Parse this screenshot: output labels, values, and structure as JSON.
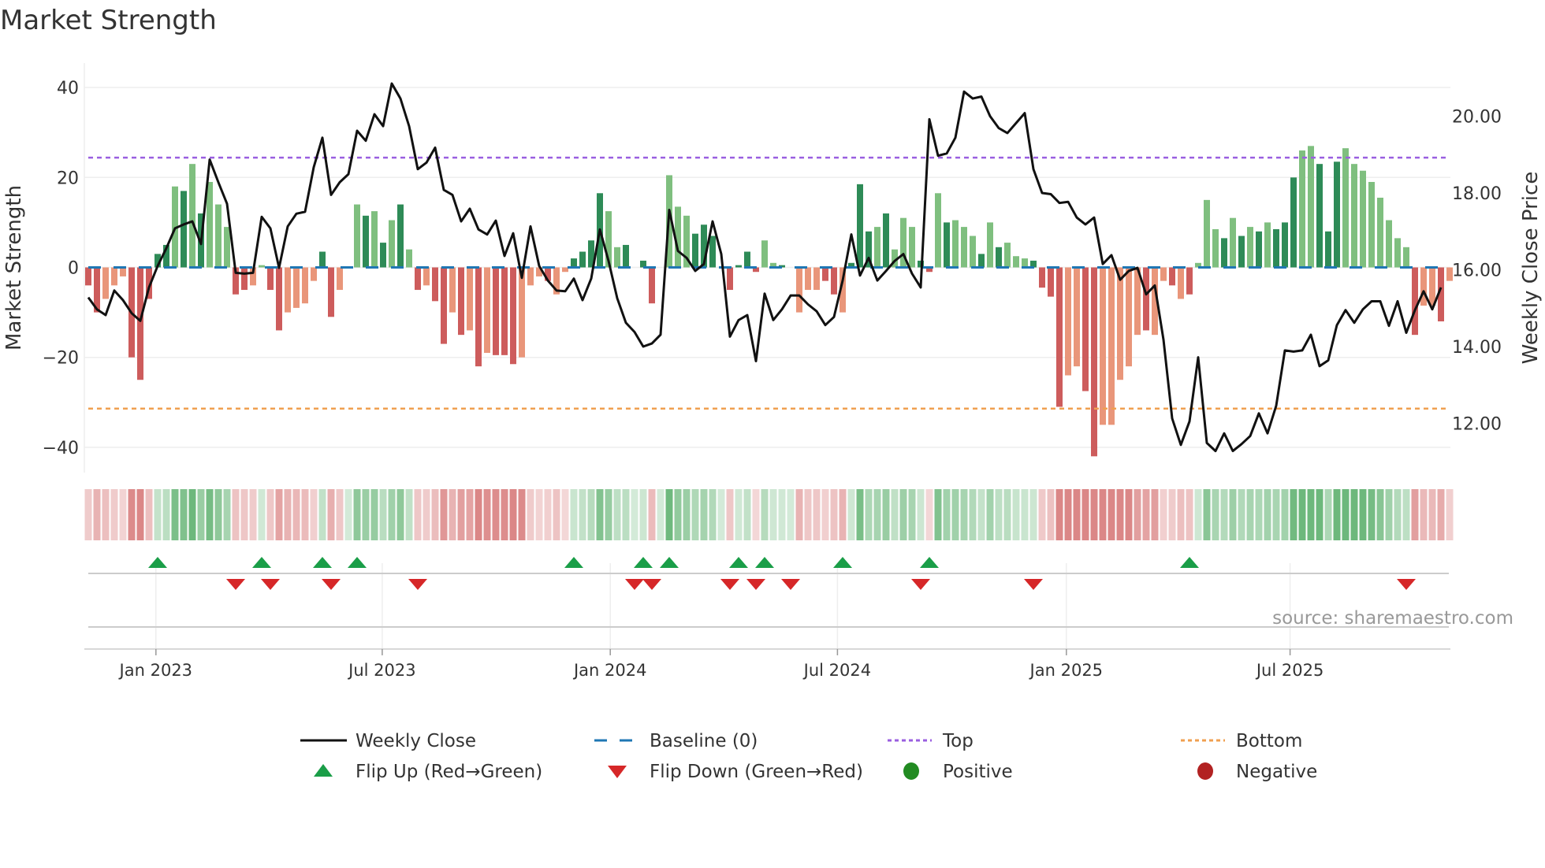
{
  "chart_data": {
    "type": "bar",
    "title": "Market Strength",
    "ylabel": "Market Strength",
    "y2label": "Weekly Close Price",
    "ylim": [
      -45,
      45
    ],
    "y2lim": [
      11.1,
      21.3
    ],
    "yticks": [
      "40",
      "20",
      "0",
      "−20",
      "−40"
    ],
    "ytick_values": [
      40,
      20,
      0,
      -20,
      -40
    ],
    "y2ticks": [
      "20.00",
      "18.00",
      "16.00",
      "14.00",
      "12.00"
    ],
    "y2tick_values": [
      20,
      18,
      16,
      14,
      12
    ],
    "xticks": [
      {
        "label": "Jan 2023",
        "week": 7.8
      },
      {
        "label": "Jul 2023",
        "week": 33.9
      },
      {
        "label": "Jan 2024",
        "week": 60.2
      },
      {
        "label": "Jul 2024",
        "week": 86.4
      },
      {
        "label": "Jan 2025",
        "week": 112.8
      },
      {
        "label": "Jul 2025",
        "week": 138.6
      }
    ],
    "top_threshold": 24.4,
    "bottom_threshold": -31.4,
    "strength": [
      -4,
      -10,
      -7,
      -4,
      -2,
      -20,
      -25,
      -7,
      3,
      5,
      18,
      17,
      23,
      12,
      19,
      14,
      9,
      -6,
      -5,
      -4,
      0.5,
      -5,
      -14,
      -10,
      -9,
      -8,
      -3,
      3.5,
      -11,
      -5,
      0,
      14,
      11.5,
      12.5,
      5.5,
      10.5,
      14,
      4,
      -5,
      -4,
      -7.5,
      -17,
      -10,
      -15,
      -14,
      -22,
      -19,
      -19.5,
      -19.5,
      -21.5,
      -20,
      -4,
      -2,
      -3,
      -6,
      -1,
      2,
      3.5,
      6,
      16.5,
      12.5,
      4.5,
      5,
      0,
      1.5,
      -8,
      0,
      20.5,
      13.5,
      11.5,
      7.5,
      9.5,
      7,
      0,
      -5,
      0.5,
      3.5,
      -1,
      6,
      1,
      0.5,
      0,
      -10,
      -5,
      -5,
      -3,
      -6,
      -10,
      1,
      18.5,
      8,
      9,
      12,
      4,
      11,
      9,
      1.5,
      -1,
      16.5,
      10,
      10.5,
      9,
      7,
      3,
      10,
      4.5,
      5.5,
      2.5,
      2,
      1.5,
      -4.5,
      -6.5,
      -31,
      -24,
      -22,
      -27.5,
      -42,
      -35,
      -35,
      -25,
      -22,
      -15,
      -14,
      -15,
      -3,
      -4,
      -7,
      -6,
      1,
      15,
      8.5,
      6.5,
      11,
      7,
      9,
      8,
      10,
      8.5,
      10,
      20,
      26,
      27,
      23,
      8,
      23.5,
      26.5,
      23,
      21.5,
      19,
      15.5,
      10.5,
      6.5,
      4.5,
      -15,
      -8.5,
      -8.5,
      -12,
      -3
    ],
    "shade": "ddllldddddldldlllddllddllllddldldldldldlddldldldddllldllddddlldddddlllddddddddllddlllddldddldlllddldllldldlllddddllddllllldlldldllldldldldddlldddlllllllldlldl",
    "close": [
      15.28,
      14.97,
      14.82,
      15.46,
      15.21,
      14.87,
      14.67,
      15.54,
      16.1,
      16.56,
      17.08,
      17.18,
      17.26,
      16.67,
      18.87,
      18.28,
      17.72,
      15.92,
      15.9,
      15.92,
      17.38,
      17.08,
      16.05,
      17.13,
      17.46,
      17.51,
      18.67,
      19.44,
      17.95,
      18.28,
      18.49,
      19.62,
      19.36,
      20.05,
      19.74,
      20.85,
      20.46,
      19.74,
      18.62,
      18.79,
      19.18,
      18.08,
      17.95,
      17.26,
      17.59,
      17.05,
      16.92,
      17.28,
      16.36,
      16.95,
      15.79,
      17.13,
      16.1,
      15.72,
      15.46,
      15.44,
      15.77,
      15.21,
      15.77,
      17.05,
      16.23,
      15.26,
      14.62,
      14.38,
      14.0,
      14.08,
      14.31,
      17.56,
      16.49,
      16.31,
      15.97,
      16.15,
      17.26,
      16.41,
      14.26,
      14.69,
      14.82,
      13.62,
      15.38,
      14.69,
      14.97,
      15.33,
      15.33,
      15.1,
      14.92,
      14.56,
      14.77,
      15.72,
      16.92,
      15.85,
      16.31,
      15.72,
      15.97,
      16.23,
      16.41,
      15.9,
      15.54,
      19.92,
      18.97,
      19.03,
      19.44,
      20.64,
      20.46,
      20.51,
      20.0,
      19.69,
      19.56,
      19.82,
      20.08,
      18.62,
      18.0,
      17.97,
      17.74,
      17.77,
      17.36,
      17.18,
      17.36,
      16.15,
      16.38,
      15.74,
      15.97,
      16.05,
      15.36,
      15.59,
      14.18,
      12.13,
      11.44,
      12.05,
      13.72,
      11.49,
      11.28,
      11.74,
      11.28,
      11.46,
      11.67,
      12.26,
      11.74,
      12.46,
      13.9,
      13.87,
      13.9,
      14.31,
      13.49,
      13.64,
      14.56,
      14.95,
      14.62,
      14.97,
      15.18,
      15.18,
      14.54,
      15.18,
      14.36,
      14.95,
      15.44,
      14.97,
      15.54
    ],
    "flip_up_weeks": [
      8,
      20,
      27,
      31,
      56,
      64,
      67,
      75,
      78,
      87,
      97,
      127
    ],
    "flip_down_weeks": [
      17,
      21,
      28,
      38,
      63,
      65,
      74,
      77,
      81,
      96,
      109,
      152
    ],
    "legend": [
      {
        "label": "Weekly Close",
        "kind": "line"
      },
      {
        "label": "Baseline (0)",
        "kind": "dash"
      },
      {
        "label": "Top",
        "kind": "dot-purple"
      },
      {
        "label": "Bottom",
        "kind": "dot-orange"
      },
      {
        "label": "Flip Up (Red→Green)",
        "kind": "tri-up"
      },
      {
        "label": "Flip Down (Green→Red)",
        "kind": "tri-down"
      },
      {
        "label": "Positive",
        "kind": "circle-green"
      },
      {
        "label": "Negative",
        "kind": "circle-red"
      }
    ],
    "legend_placement": "bottom",
    "source": "source: sharemaestro.com",
    "colors": {
      "pos_dark": "#2e8b57",
      "pos_light": "#7fbf7f",
      "neg_dark": "#cd5c5c",
      "neg_light": "#e9967a",
      "line": "#111111",
      "baseline": "#1f77b4",
      "top": "#9a5fe0",
      "bottom": "#f0a050",
      "up": "#1a9e48",
      "down": "#d62728",
      "pos_dot": "#228b22",
      "neg_dot": "#b22222"
    }
  }
}
